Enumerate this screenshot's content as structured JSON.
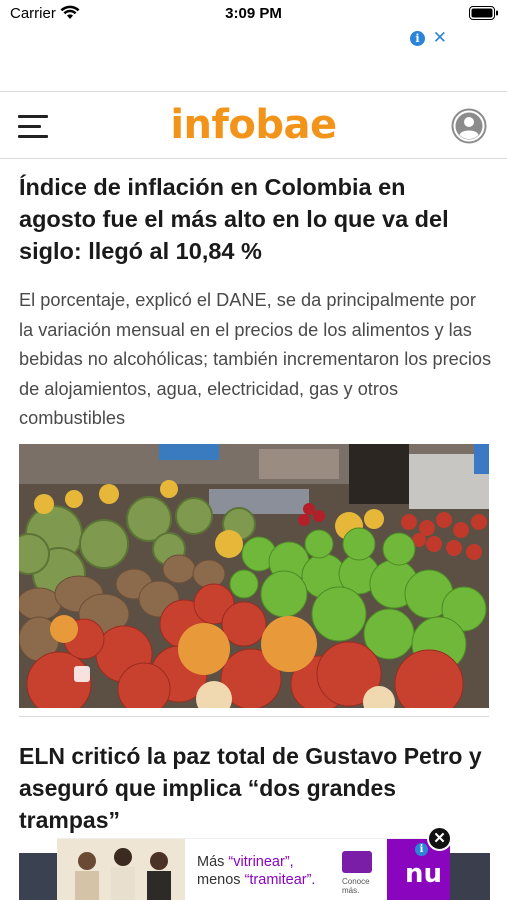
{
  "status_bar": {
    "carrier": "Carrier",
    "time": "3:09 PM"
  },
  "ad_top": {
    "info_icon": "i",
    "close_icon": "✕"
  },
  "header": {
    "logo": "infobae",
    "menu_icon": "hamburger-menu-icon",
    "account_icon": "user-avatar-icon",
    "brand_color": "#f29419"
  },
  "articles": [
    {
      "title": "Índice de inflación en Colombia en agosto fue el más alto en lo que va del siglo: llegó al 10,84 %",
      "summary": "El porcentaje, explicó el DANE, se da principalmente por la variación mensual en el precios de los alimentos y las bebidas no alcohólicas; también incrementaron los precios de alojamientos, agua, electricidad, gas y otros combustibles"
    },
    {
      "title": "ELN criticó la paz total de Gustavo Petro y aseguró que implica “dos grandes trampas”"
    }
  ],
  "ad_bottom": {
    "line1_prefix": "Más ",
    "line1_accent": "“vitrinear”,",
    "line2_prefix": "menos ",
    "line2_accent": "“tramitear”.",
    "cta": "Conoce más.",
    "brand": "nu",
    "brand_color": "#8a05be",
    "close_icon": "✕",
    "info_icon": "i"
  }
}
